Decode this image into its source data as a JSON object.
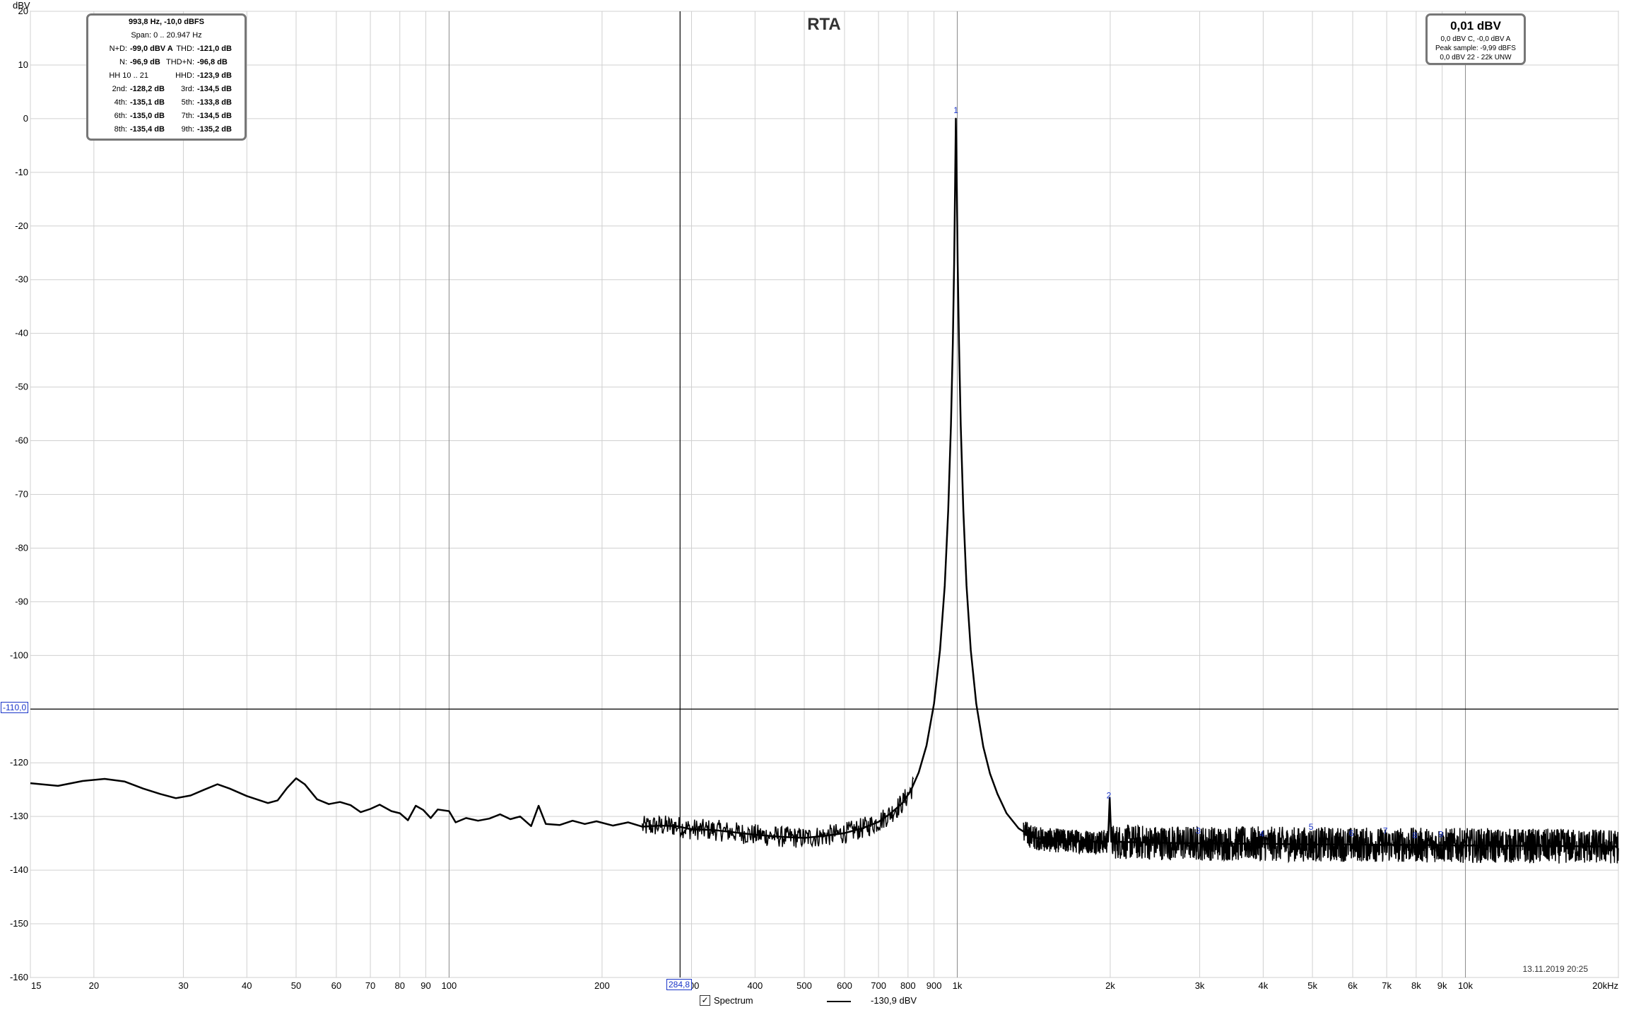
{
  "chart_data": {
    "type": "line",
    "title": "RTA",
    "ylabel": "dBV",
    "xunit": "kHz",
    "xscale": "log",
    "xlim": [
      15,
      20000
    ],
    "ylim": [
      -160,
      20
    ],
    "grid": true,
    "yticks": [
      20,
      10,
      0,
      -10,
      -20,
      -30,
      -40,
      -50,
      -60,
      -70,
      -80,
      -90,
      -100,
      -110,
      -120,
      -130,
      -140,
      -150,
      -160
    ],
    "xticks": [
      {
        "v": 15,
        "label": "15"
      },
      {
        "v": 20,
        "label": "20"
      },
      {
        "v": 30,
        "label": "30"
      },
      {
        "v": 40,
        "label": "40"
      },
      {
        "v": 50,
        "label": "50"
      },
      {
        "v": 60,
        "label": "60"
      },
      {
        "v": 70,
        "label": "70"
      },
      {
        "v": 80,
        "label": "80"
      },
      {
        "v": 90,
        "label": "90"
      },
      {
        "v": 100,
        "label": "100"
      },
      {
        "v": 200,
        "label": "200"
      },
      {
        "v": 300,
        "label": "300"
      },
      {
        "v": 400,
        "label": "400"
      },
      {
        "v": 500,
        "label": "500"
      },
      {
        "v": 600,
        "label": "600"
      },
      {
        "v": 700,
        "label": "700"
      },
      {
        "v": 800,
        "label": "800"
      },
      {
        "v": 900,
        "label": "900"
      },
      {
        "v": 1000,
        "label": "1k"
      },
      {
        "v": 2000,
        "label": "2k"
      },
      {
        "v": 3000,
        "label": "3k"
      },
      {
        "v": 4000,
        "label": "4k"
      },
      {
        "v": 5000,
        "label": "5k"
      },
      {
        "v": 6000,
        "label": "6k"
      },
      {
        "v": 7000,
        "label": "7k"
      },
      {
        "v": 8000,
        "label": "8k"
      },
      {
        "v": 9000,
        "label": "9k"
      },
      {
        "v": 10000,
        "label": "10k"
      },
      {
        "v": 20000,
        "label": "20kHz"
      }
    ],
    "series": [
      {
        "name": "Spectrum",
        "color": "#000000",
        "points": [
          [
            15,
            -123.8
          ],
          [
            17,
            -124.3
          ],
          [
            19,
            -123.4
          ],
          [
            21,
            -123.0
          ],
          [
            23,
            -123.5
          ],
          [
            25,
            -124.8
          ],
          [
            27,
            -125.8
          ],
          [
            29,
            -126.6
          ],
          [
            31,
            -126.1
          ],
          [
            33,
            -125.0
          ],
          [
            35,
            -124.0
          ],
          [
            37,
            -124.8
          ],
          [
            40,
            -126.2
          ],
          [
            44,
            -127.5
          ],
          [
            46,
            -127.0
          ],
          [
            48,
            -124.7
          ],
          [
            50,
            -122.9
          ],
          [
            52,
            -124.0
          ],
          [
            55,
            -126.8
          ],
          [
            58,
            -127.7
          ],
          [
            61,
            -127.3
          ],
          [
            64,
            -127.9
          ],
          [
            67,
            -129.2
          ],
          [
            70,
            -128.6
          ],
          [
            73,
            -127.8
          ],
          [
            77,
            -129.0
          ],
          [
            80,
            -129.4
          ],
          [
            83,
            -130.7
          ],
          [
            86,
            -128.0
          ],
          [
            89,
            -128.8
          ],
          [
            92,
            -130.3
          ],
          [
            95,
            -128.7
          ],
          [
            100,
            -129.0
          ],
          [
            103,
            -131.1
          ],
          [
            108,
            -130.3
          ],
          [
            114,
            -130.8
          ],
          [
            120,
            -130.4
          ],
          [
            126,
            -129.6
          ],
          [
            132,
            -130.5
          ],
          [
            138,
            -130.0
          ],
          [
            145,
            -131.8
          ],
          [
            150,
            -128.0
          ],
          [
            155,
            -131.4
          ],
          [
            165,
            -131.6
          ],
          [
            175,
            -130.8
          ],
          [
            185,
            -131.4
          ],
          [
            195,
            -130.9
          ],
          [
            210,
            -131.7
          ],
          [
            225,
            -131.1
          ],
          [
            240,
            -131.9
          ],
          [
            260,
            -131.7
          ],
          [
            280,
            -131.8
          ],
          [
            300,
            -132.4
          ],
          [
            330,
            -132.5
          ],
          [
            360,
            -132.9
          ],
          [
            400,
            -133.4
          ],
          [
            450,
            -133.8
          ],
          [
            500,
            -134.0
          ],
          [
            550,
            -133.6
          ],
          [
            600,
            -133.1
          ],
          [
            650,
            -132.2
          ],
          [
            700,
            -131.0
          ],
          [
            740,
            -129.4
          ],
          [
            780,
            -127.5
          ],
          [
            810,
            -125.2
          ],
          [
            840,
            -121.8
          ],
          [
            870,
            -116.8
          ],
          [
            900,
            -109.0
          ],
          [
            925,
            -99.0
          ],
          [
            945,
            -87.0
          ],
          [
            960,
            -73.0
          ],
          [
            972,
            -57.0
          ],
          [
            980,
            -42.0
          ],
          [
            986,
            -27.0
          ],
          [
            990,
            -13.0
          ],
          [
            993.8,
            0.0
          ],
          [
            998,
            -13.0
          ],
          [
            1002,
            -27.0
          ],
          [
            1008,
            -42.0
          ],
          [
            1016,
            -57.0
          ],
          [
            1028,
            -73.0
          ],
          [
            1043,
            -87.0
          ],
          [
            1063,
            -99.0
          ],
          [
            1090,
            -109.0
          ],
          [
            1125,
            -117.0
          ],
          [
            1160,
            -122.0
          ],
          [
            1200,
            -125.8
          ],
          [
            1250,
            -129.4
          ],
          [
            1320,
            -132.2
          ],
          [
            1400,
            -133.8
          ],
          [
            1500,
            -134.4
          ],
          [
            1700,
            -134.6
          ],
          [
            1900,
            -134.7
          ],
          [
            1980,
            -134.7
          ],
          [
            1995,
            -126.5
          ],
          [
            2010,
            -134.7
          ],
          [
            2500,
            -134.9
          ],
          [
            3000,
            -135.0
          ],
          [
            4000,
            -135.1
          ],
          [
            5000,
            -135.2
          ],
          [
            6000,
            -135.2
          ],
          [
            7000,
            -135.3
          ],
          [
            8000,
            -135.3
          ],
          [
            10000,
            -135.4
          ],
          [
            14000,
            -135.5
          ],
          [
            20000,
            -135.6
          ]
        ]
      }
    ],
    "harmonic_markers": [
      {
        "label": "1",
        "f": 993.8,
        "db": 0.0
      },
      {
        "label": "2",
        "f": 1987.6,
        "db": -128.2
      },
      {
        "label": "3",
        "f": 2981.4,
        "db": -134.5
      },
      {
        "label": "4",
        "f": 3975.2,
        "db": -135.1
      },
      {
        "label": "5",
        "f": 4969.0,
        "db": -133.8
      },
      {
        "label": "6",
        "f": 5962.8,
        "db": -135.0
      },
      {
        "label": "7",
        "f": 6956.6,
        "db": -134.5
      },
      {
        "label": "8",
        "f": 7950.4,
        "db": -135.4
      },
      {
        "label": "9",
        "f": 8944.2,
        "db": -135.2
      }
    ],
    "marker_color": "#1a35c9",
    "cursors": {
      "x_value": 284.8,
      "y_value": -110.0
    },
    "grid_color": "#d0d0d0",
    "cursor_color": "#000000"
  },
  "labels": {
    "ylabel": "dBV",
    "title": "RTA",
    "ycursor_label": "-110,0",
    "xcursor_label": "284,8",
    "timestamp": "13.11.2019 20:25"
  },
  "info_left": {
    "header1": "993,8 Hz, -10,0 dBFS",
    "header2": "Span: 0 .. 20.947 Hz",
    "rows": [
      {
        "l1": "N+D:",
        "v1": "-99,0 dBV A",
        "l2": "THD:",
        "v2": "-121,0 dB"
      },
      {
        "l1": "N:",
        "v1": "-96,9 dB",
        "l2": "THD+N:",
        "v2": "-96,8 dB"
      },
      {
        "l1": "HH 10 .. 21",
        "v1": "",
        "l2": "HHD:",
        "v2": "-123,9 dB"
      },
      {
        "l1": "2nd:",
        "v1": "-128,2 dB",
        "l2": "3rd:",
        "v2": "-134,5 dB"
      },
      {
        "l1": "4th:",
        "v1": "-135,1 dB",
        "l2": "5th:",
        "v2": "-133,8 dB"
      },
      {
        "l1": "6th:",
        "v1": "-135,0 dB",
        "l2": "7th:",
        "v2": "-134,5 dB"
      },
      {
        "l1": "8th:",
        "v1": "-135,4 dB",
        "l2": "9th:",
        "v2": "-135,2 dB"
      }
    ]
  },
  "info_right": {
    "main": "0,01 dBV",
    "line1": "0,0 dBV C, -0,0 dBV A",
    "line2": "Peak sample: -9,99 dBFS",
    "line3": "0,0 dBV 22 - 22k UNW"
  },
  "legend": {
    "checked": true,
    "checkmark": "✓",
    "name": "Spectrum",
    "value": "-130,9 dBV"
  }
}
